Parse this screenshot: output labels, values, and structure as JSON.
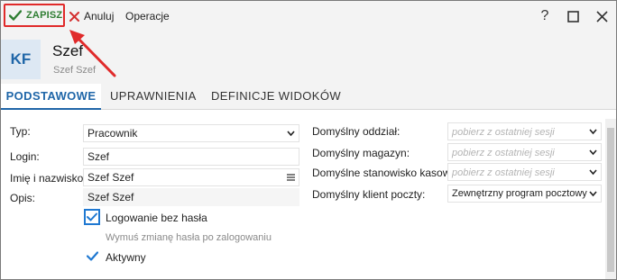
{
  "toolbar": {
    "save_label": "ZAPISZ",
    "cancel_label": "Anuluj",
    "operations_label": "Operacje",
    "help_label": "?"
  },
  "header": {
    "initials": "KF",
    "title": "Szef",
    "subtitle": "Szef Szef"
  },
  "tabs": [
    {
      "label": "PODSTAWOWE",
      "active": true
    },
    {
      "label": "UPRAWNIENIA",
      "active": false
    },
    {
      "label": "DEFINICJE WIDOKÓW",
      "active": false
    }
  ],
  "left_form": {
    "type": {
      "label": "Typ:",
      "value": "Pracownik"
    },
    "login": {
      "label": "Login:",
      "value": "Szef"
    },
    "name": {
      "label": "Imię i nazwisko:",
      "value": "Szef Szef"
    },
    "description": {
      "label": "Opis:",
      "value": "Szef Szef"
    }
  },
  "checkboxes": {
    "passwordless": {
      "label": "Logowanie bez hasła",
      "checked": true
    },
    "force_change": {
      "label": "Wymuś zmianę hasła po zalogowaniu",
      "checked": false,
      "disabled": true
    },
    "active": {
      "label": "Aktywny",
      "checked": true
    }
  },
  "right_form": {
    "department": {
      "label": "Domyślny oddział:",
      "placeholder": "pobierz z ostatniej sesji"
    },
    "warehouse": {
      "label": "Domyślny magazyn:",
      "placeholder": "pobierz z ostatniej sesji"
    },
    "cash_station": {
      "label": "Domyślne stanowisko kasowe:",
      "placeholder": "pobierz z ostatniej sesji"
    },
    "mail_client": {
      "label": "Domyślny klient poczty:",
      "value": "Zewnętrzny program pocztowy"
    }
  },
  "colors": {
    "accent": "#1f66a8",
    "save_green": "#2e7d32",
    "highlight_red": "#e02a2a",
    "cancel_red": "#d32f2f",
    "checkbox_blue": "#1f78d1"
  },
  "icons": {
    "save": "check-icon",
    "cancel": "x-icon",
    "help": "question-icon",
    "maximize": "maximize-icon",
    "close": "close-icon",
    "dropdown": "chevron-down-icon",
    "menu": "hamburger-icon"
  }
}
